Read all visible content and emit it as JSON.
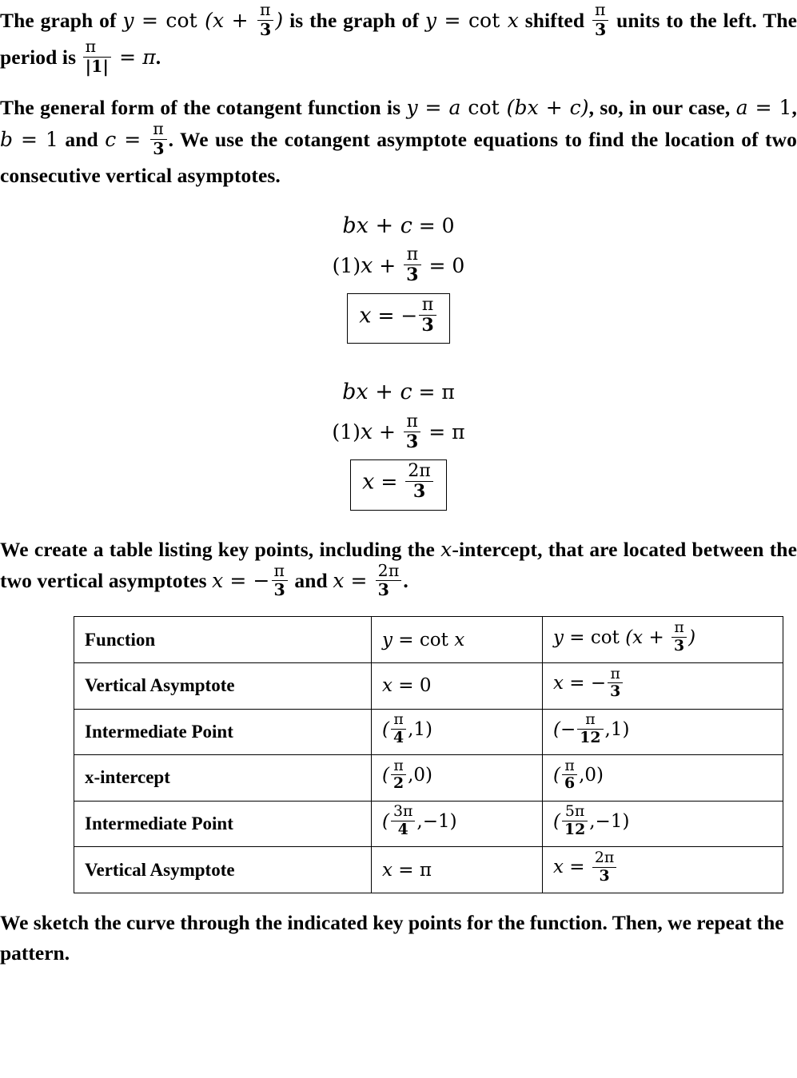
{
  "document": {
    "paragraph_1": {
      "segments": [
        "The graph of ",
        "y = cot (x + π/3)",
        " is the graph of ",
        "y = cot x",
        " shifted ",
        "π/3",
        " units to the left. The period is ",
        "π/|1| = π",
        "."
      ],
      "plain_text": "The graph of y = cot (x + π/3) is the graph of y = cot x shifted π/3 units to the left. The period is π/|1| = π."
    },
    "paragraph_2": {
      "plain_text": "The general form of the cotangent function is y = a cot (bx + c), so, in our case, a = 1, b = 1 and c = π/3. We use the cotangent asymptote equations to find the location of two consecutive vertical asymptotes.",
      "general_form": "y = a cot (bx + c)",
      "a_value": "a = 1",
      "b_value": "b = 1",
      "c_label": "c =",
      "c_num": "π",
      "c_den": "3"
    },
    "equation_group_1": {
      "line_1": "bx + c = 0",
      "line_2_prefix": "(1)x +",
      "line_2_num": "π",
      "line_2_den": "3",
      "line_2_suffix": "= 0",
      "boxed_prefix": "x = −",
      "boxed_num": "π",
      "boxed_den": "3"
    },
    "equation_group_2": {
      "line_1": "bx + c = π",
      "line_2_prefix": "(1)x +",
      "line_2_num": "π",
      "line_2_den": "3",
      "line_2_suffix": "= π",
      "boxed_prefix": "x =",
      "boxed_num": "2π",
      "boxed_den": "3"
    },
    "paragraph_3": {
      "text_part_1": "We create a table listing key points, including the ",
      "x_italic": "x",
      "text_part_2": "-intercept, that are located between the two vertical asymptotes ",
      "asym_left_prefix": "x = −",
      "asym_left_num": "π",
      "asym_left_den": "3",
      "and_word": " and ",
      "asym_right_prefix": "x =",
      "asym_right_num": "2π",
      "asym_right_den": "3",
      "period": "."
    },
    "table": {
      "header": {
        "col1": "Function",
        "col2": "y = cot x",
        "col3": "y = cot (x + π/3)"
      },
      "rows": [
        {
          "label": "Vertical Asymptote",
          "col2": "x = 0",
          "col3": "x = −π/3"
        },
        {
          "label": "Intermediate Point",
          "col2": "(π/4 , 1)",
          "col3": "(−π/12 , 1)"
        },
        {
          "label": "x-intercept",
          "col2": "(π/2 , 0)",
          "col3": "(π/6 , 0)"
        },
        {
          "label": "Intermediate Point",
          "col2": "(3π/4 , −1)",
          "col3": "(5π/12 , −1)"
        },
        {
          "label": "Vertical Asymptote",
          "col2": "x = π",
          "col3": "x = 2π/3"
        }
      ]
    },
    "paragraph_4": {
      "plain_text": "We sketch the curve through the indicated key points for the function. Then, we repeat the pattern."
    }
  }
}
